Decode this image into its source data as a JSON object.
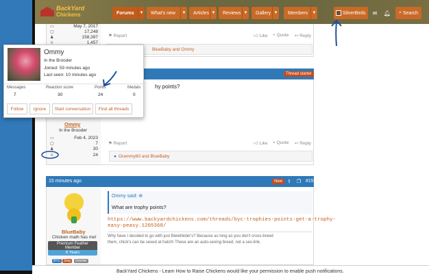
{
  "site": {
    "logo_line1": "BackYard",
    "logo_line2": "Chickens"
  },
  "nav": [
    {
      "label": "Forums"
    },
    {
      "label": "What's new"
    },
    {
      "label": "Articles"
    },
    {
      "label": "Reviews"
    },
    {
      "label": "Gallery"
    },
    {
      "label": "Members"
    }
  ],
  "header": {
    "username": "SilverBirds",
    "search_label": "Search"
  },
  "top_post": {
    "stats": [
      "May 7, 2017",
      "17,248",
      "158,397",
      "1,457"
    ],
    "report": "Report",
    "like": "Like",
    "quote": "Quote",
    "reply": "Reply",
    "reactions": "BlueBaby and Ommy"
  },
  "post2": {
    "badge_starter": "Thread starter",
    "number": "#14",
    "snippet": "hy points?",
    "username": "Ommy",
    "title": "In the Brooder",
    "stats": [
      "Feb 4, 2023",
      "7",
      "30",
      "24"
    ],
    "report": "Report",
    "like": "Like",
    "quote": "Quote",
    "reply": "Reply",
    "reactions": "Grammy60 and BlueBaby"
  },
  "post3": {
    "time": "15 minutes ago",
    "badge_new": "New",
    "number": "#15",
    "username": "BlueBaby",
    "title": "Chicken math has me!",
    "member_badge": "Premium Feather Member",
    "years_badge": "6 Years",
    "small_badges": [
      "BYC",
      "Sing",
      "Greeter"
    ],
    "quote_author": "Ommy said:",
    "quote_text": "What are trophy points?",
    "link_line1": "https://www.backyardchickens.com/threads/byc-trophies-points-get-a-trophy-",
    "link_line2": "easy-peasy.1205368/",
    "body_line1": "Why have I decided to go with just Bielefelder's? Because as long as you don't cross-breed",
    "body_line2": "them, chick's can be sexed at hatch! These are an auto-sexing breed, not a sex-link."
  },
  "popup": {
    "username": "Ommy",
    "title": "In the Brooder",
    "joined": "Joined: 59 minutes ago",
    "last_seen": "Last seen: 10 minutes ago",
    "stats": [
      {
        "label": "Messages",
        "value": "7"
      },
      {
        "label": "Reaction score",
        "value": "30"
      },
      {
        "label": "Points",
        "value": "24"
      },
      {
        "label": "Medals",
        "value": "0"
      }
    ],
    "buttons": [
      "Follow",
      "Ignore",
      "Start conversation",
      "Find all threads"
    ]
  },
  "push_notice": "BackYard Chickens - Learn How to Raise Chickens would like your permission to enable push notifications.",
  "colors": {
    "header": "#6c6840",
    "nav_orange": "#c96a26",
    "post_header_blue": "#2f79b9",
    "link_orange": "#c35f1e"
  }
}
